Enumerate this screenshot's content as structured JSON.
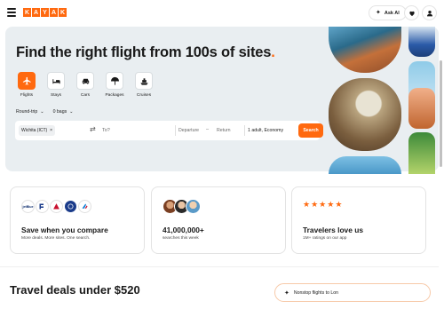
{
  "header": {
    "logo_letters": [
      "K",
      "A",
      "Y",
      "A",
      "K"
    ],
    "ask_ai_label": "Ask AI",
    "brand_color": "#ff690f"
  },
  "hero": {
    "title": "Find the right flight from 100s of sites",
    "title_dot": ".",
    "verticals": [
      {
        "label": "Flights",
        "icon": "plane-icon",
        "active": true
      },
      {
        "label": "Stays",
        "icon": "bed-icon",
        "active": false
      },
      {
        "label": "Cars",
        "icon": "car-icon",
        "active": false
      },
      {
        "label": "Packages",
        "icon": "umbrella-icon",
        "active": false
      },
      {
        "label": "Cruises",
        "icon": "ship-icon",
        "active": false
      }
    ],
    "trip_type": "Round-trip",
    "bags": "0 bags"
  },
  "search": {
    "origin": "Wichita (ICT)",
    "destination_placeholder": "To?",
    "depart_placeholder": "Departure",
    "return_placeholder": "Return",
    "travelers": "1 adult, Economy",
    "search_label": "Search"
  },
  "cards": [
    {
      "title": "Save when you compare",
      "subtitle": "More deals. More sites. One search."
    },
    {
      "title": "41,000,000+",
      "subtitle": "searches this week"
    },
    {
      "title": "Travelers love us",
      "subtitle": "1M+ ratings on our app"
    }
  ],
  "partner_logos": [
    {
      "text": "jetBlue",
      "color": "#0b2b6b"
    },
    {
      "text": "",
      "color": "#6b6b6b"
    },
    {
      "text": "",
      "color": "#c8102e"
    },
    {
      "text": "",
      "color": "#1a3b8a"
    },
    {
      "text": "",
      "color": "#0078d2"
    }
  ],
  "stars": [
    "★",
    "★",
    "★",
    "★",
    "★"
  ],
  "deals": {
    "title": "Travel deals under $520",
    "ai_prompt": "Nonstop flights to Lon"
  }
}
